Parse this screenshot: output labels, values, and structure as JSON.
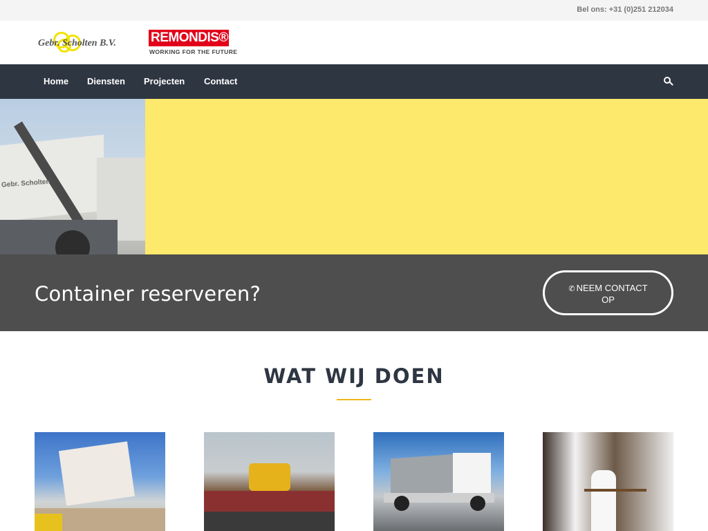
{
  "topbar": {
    "phone": "Bel ons: +31 (0)251 212034"
  },
  "header": {
    "logo_gs": "Gebr. Scholten B.V.",
    "logo_remondis": "REMONDIS®",
    "logo_remondis_tagline": "WORKING FOR THE FUTURE"
  },
  "nav": {
    "items": [
      {
        "label": "Home"
      },
      {
        "label": "Diensten"
      },
      {
        "label": "Projecten"
      },
      {
        "label": "Contact"
      }
    ],
    "search_icon": "search-icon"
  },
  "hero": {
    "photo_caption": "Gebr. Scholten"
  },
  "cta": {
    "title": "Container reserveren?",
    "button_icon": "phone-icon",
    "button_line1": "NEEM CONTACT",
    "button_line2": "OP"
  },
  "services": {
    "title": "WAT WIJ DOEN"
  },
  "colors": {
    "navbar": "#2e3642",
    "hero": "#fde96b",
    "cta": "#4e4e4e",
    "accent": "#f0b71a",
    "remondis_red": "#e2001a"
  }
}
